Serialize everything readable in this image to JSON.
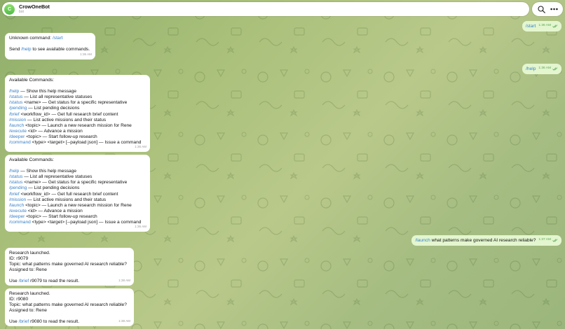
{
  "header": {
    "avatar_letter": "C",
    "title": "CrowOneBot",
    "subtitle": "bot",
    "search_icon": "search-icon",
    "more_icon": "more-icon"
  },
  "colors": {
    "link": "#3a82c8",
    "outgoing_bubble": "#e3f6cf",
    "incoming_bubble": "#ffffff",
    "avatar": "#4fbb48"
  },
  "messages": {
    "m1": {
      "cmd": "/start",
      "time": "1:36 AM"
    },
    "m2": {
      "line1": "Unknown command: ",
      "line1_cmd": "/start",
      "line2_pre": "Send ",
      "line2_cmd": "/help",
      "line2_post": " to see available commands.",
      "time": "1:36 AM"
    },
    "m3": {
      "cmd": "/help",
      "time": "1:36 AM"
    },
    "help": {
      "heading": "Available Commands:",
      "items": [
        {
          "cmd": "/help",
          "text": " — Show this help message"
        },
        {
          "cmd": "/status",
          "text": " — List all representative statuses"
        },
        {
          "cmd": "/status",
          "text": " <name> — Get status for a specific representative"
        },
        {
          "cmd": "/pending",
          "text": " — List pending decisions"
        },
        {
          "cmd": "/brief",
          "text": " <workflow_id> — Get full research brief content"
        },
        {
          "cmd": "/mission",
          "text": " — List active missions and their status"
        },
        {
          "cmd": "/launch",
          "text": " <topic> — Launch a new research mission for Rene"
        },
        {
          "cmd": "/execute",
          "text": " <id> — Advance a mission"
        },
        {
          "cmd": "/deeper",
          "text": " <topic> — Start follow-up research"
        },
        {
          "cmd": "/command",
          "text": " <type> <target> [--payload json] — Issue a command"
        }
      ],
      "time1": "1:36 AM",
      "time2": "1:36 AM"
    },
    "m6": {
      "cmd": "/launch",
      "text": " what patterns make governed AI research reliable?",
      "time": "1:37 AM"
    },
    "r1": {
      "line1": "Research launched.",
      "line2": "ID: r9079",
      "line3": "Topic: what patterns make governed AI research reliable?",
      "line4": "Assigned to: Rene",
      "line5_pre": "Use ",
      "line5_cmd": "/brief",
      "line5_post": " r9079 to read the result.",
      "time": "1:38 AM"
    },
    "r2": {
      "line1": "Research launched.",
      "line2": "ID: r9080",
      "line3": "Topic: what patterns make governed AI research reliable?",
      "line4": "Assigned to: Rene",
      "line5_pre": "Use ",
      "line5_cmd": "/brief",
      "line5_post": " r9080 to read the result.",
      "time": "1:38 AM"
    }
  }
}
